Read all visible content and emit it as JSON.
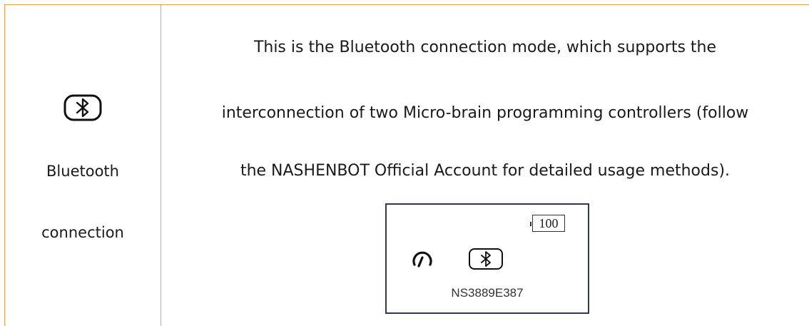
{
  "mode": {
    "icon": "bluetooth-icon",
    "label_line1": "Bluetooth",
    "label_line2": "connection"
  },
  "description": {
    "line1": "This is the Bluetooth connection mode, which supports the",
    "line2": "interconnection of two Micro-brain programming controllers (follow",
    "line3": "the NASHENBOT Official Account for detailed usage methods)."
  },
  "screen": {
    "battery": "100",
    "icons": [
      "gauge-icon",
      "bluetooth-icon"
    ],
    "device_id": "NS3889E387"
  },
  "colors": {
    "table_border": "#f0a04b",
    "screen_border": "#2e3a55"
  }
}
